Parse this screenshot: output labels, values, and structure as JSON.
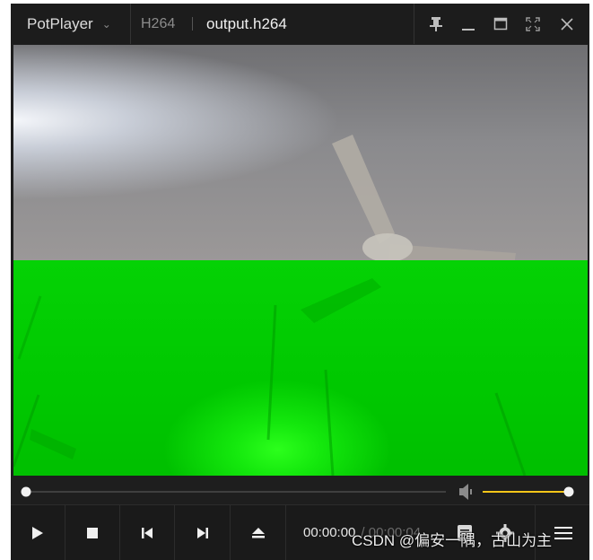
{
  "titlebar": {
    "app_name": "PotPlayer",
    "codec": "H264",
    "file_name": "output.h264",
    "icons": [
      "pin-icon",
      "minimize-icon",
      "maximize-icon",
      "fullscreen-icon",
      "close-icon"
    ]
  },
  "seek": {
    "position_fraction": 0.0
  },
  "volume": {
    "level_fraction": 1.0,
    "accent_color": "#f5c518"
  },
  "controls": {
    "current_time": "00:00:00",
    "total_time": "/ 00:00:04"
  },
  "watermark": "CSDN @偏安一隅，古山为主",
  "colors": {
    "window_bg": "#1e1e1e",
    "video_green": "#00d400"
  }
}
